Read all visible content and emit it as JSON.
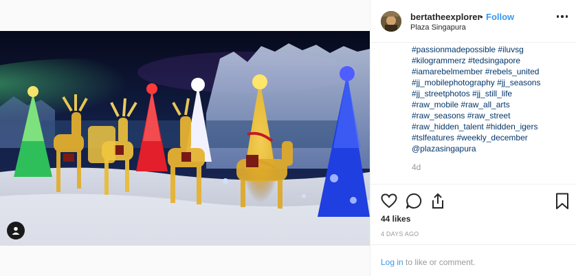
{
  "post": {
    "username": "bertatheexplorer",
    "separator": "•",
    "follow_label": "Follow",
    "location": "Plaza Singapura",
    "caption_lines": [
      "#passionmadepossible #iluvsg",
      "#kilogrammerz #tedsingapore",
      "#iamarebelmember #rebels_united",
      "#jj_mobilephotography #jj_seasons",
      "#jj_streetphotos #jj_still_life",
      "#raw_mobile #raw_all_arts",
      "#raw_seasons #raw_street",
      "#raw_hidden_talent #hidden_igers",
      "#tslfeatures #weekly_december",
      "@plazasingapura"
    ],
    "time_ago": "4d",
    "likes": "44 likes",
    "date": "4 DAYS AGO",
    "login_link": "Log in",
    "login_suffix": " to like or comment."
  },
  "icons": {
    "like": "heart-icon",
    "comment": "comment-icon",
    "share": "share-icon",
    "save": "bookmark-icon",
    "more": "more-options-icon",
    "user_tag": "user-tag-icon"
  },
  "colors": {
    "link": "#3897f0",
    "hashtag": "#003569",
    "muted": "#999999",
    "text": "#262626"
  }
}
